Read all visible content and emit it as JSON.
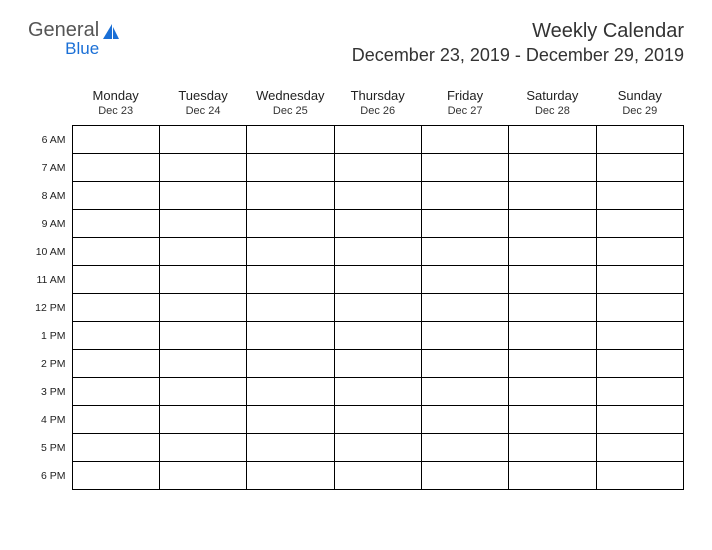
{
  "logo": {
    "text_general": "General",
    "text_blue": "Blue",
    "accent_color": "#1a6fd6"
  },
  "header": {
    "title": "Weekly Calendar",
    "date_range": "December 23, 2019 - December 29, 2019"
  },
  "days": [
    {
      "name": "Monday",
      "date": "Dec 23"
    },
    {
      "name": "Tuesday",
      "date": "Dec 24"
    },
    {
      "name": "Wednesday",
      "date": "Dec 25"
    },
    {
      "name": "Thursday",
      "date": "Dec 26"
    },
    {
      "name": "Friday",
      "date": "Dec 27"
    },
    {
      "name": "Saturday",
      "date": "Dec 28"
    },
    {
      "name": "Sunday",
      "date": "Dec 29"
    }
  ],
  "hours": [
    "6 AM",
    "7 AM",
    "8 AM",
    "9 AM",
    "10 AM",
    "11 AM",
    "12 PM",
    "1 PM",
    "2 PM",
    "3 PM",
    "4 PM",
    "5 PM",
    "6 PM"
  ]
}
